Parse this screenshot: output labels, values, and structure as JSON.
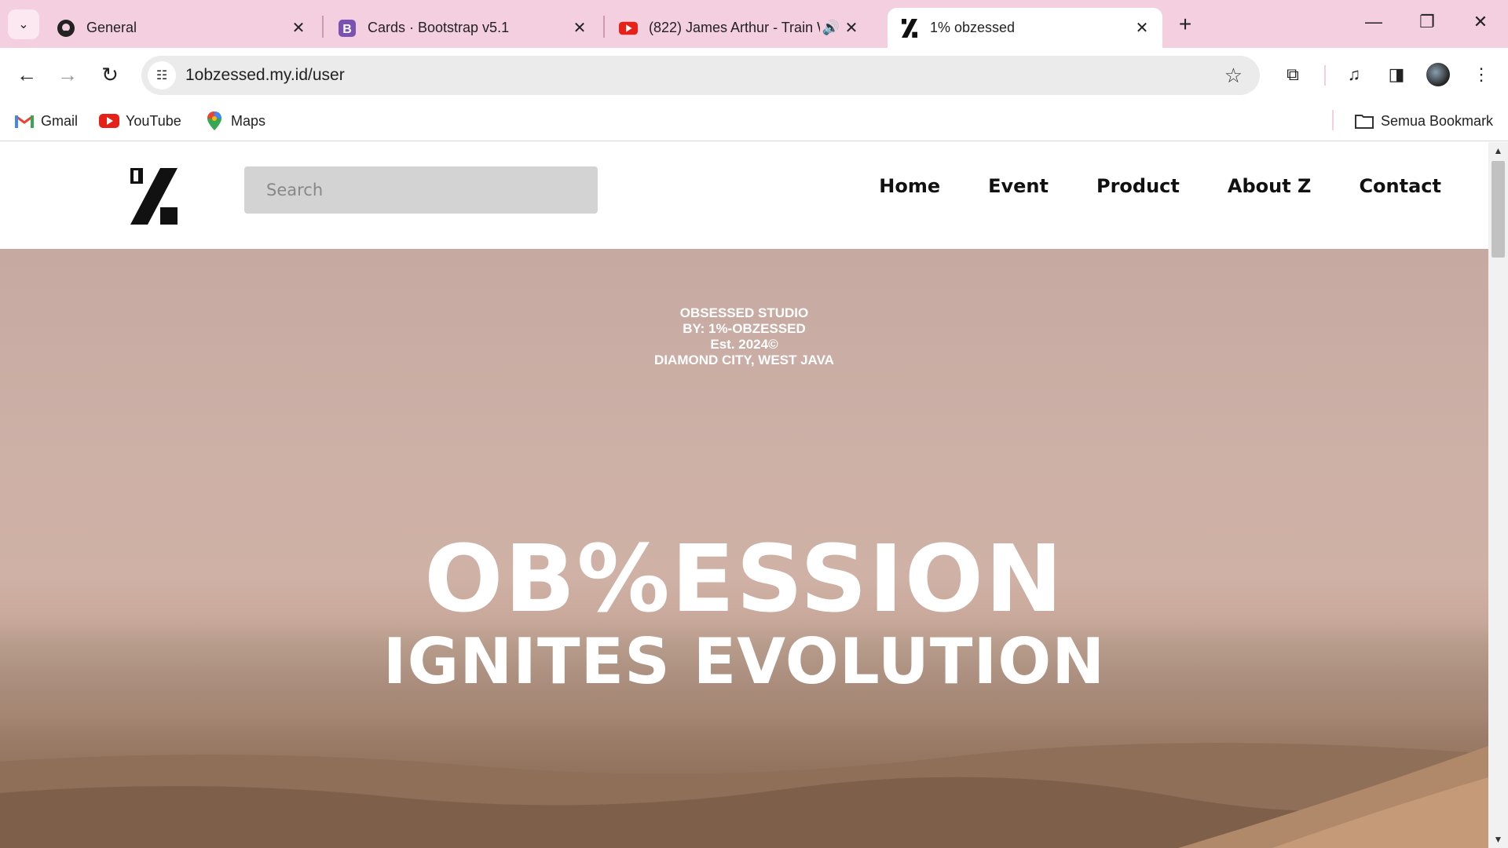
{
  "browser": {
    "tabs": [
      {
        "title": "General",
        "icon": "github-icon",
        "active": false
      },
      {
        "title": "Cards · Bootstrap v5.1",
        "icon": "bootstrap-icon",
        "active": false
      },
      {
        "title": "(822) James Arthur - Train W",
        "icon": "youtube-icon",
        "active": false,
        "audio": true
      },
      {
        "title": "1% obzessed",
        "icon": "site-logo-icon",
        "active": true
      }
    ],
    "url": "1obzessed.my.id/user",
    "bookmarks": [
      {
        "label": "Gmail",
        "icon": "gmail-icon"
      },
      {
        "label": "YouTube",
        "icon": "youtube-icon"
      },
      {
        "label": "Maps",
        "icon": "maps-icon"
      }
    ],
    "all_bookmarks_label": "Semua Bookmark",
    "colors": {
      "tabstrip": "#f4cfe0",
      "omnibox": "#ebebeb"
    }
  },
  "site": {
    "search_placeholder": "Search",
    "nav": [
      "Home",
      "Event",
      "Product",
      "About Z",
      "Contact"
    ],
    "hero": {
      "studio_lines": [
        "OBSESSED STUDIO",
        "BY: 1%-OBZESSED",
        "Est. 2024©",
        "DIAMOND CITY, WEST JAVA"
      ],
      "headline_line1": "OB%ESSION",
      "headline_line2": "IGNITES EVOLUTION"
    }
  }
}
